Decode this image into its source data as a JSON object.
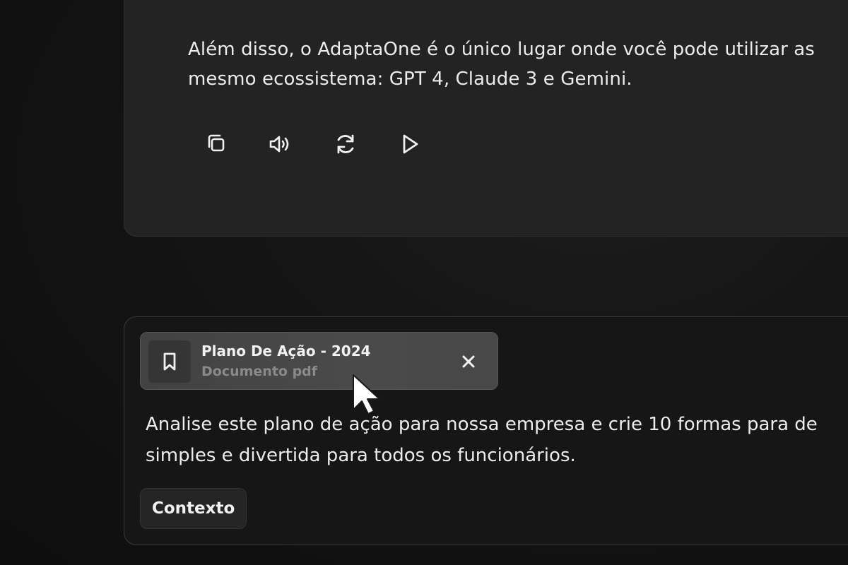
{
  "assistant_message": {
    "lines": [
      "Além disso, o AdaptaOne é o único lugar onde você pode utilizar as",
      "mesmo ecossistema: GPT 4, Claude 3 e Gemini."
    ],
    "actions": [
      {
        "name": "copy-icon",
        "label": "Copiar"
      },
      {
        "name": "speaker-icon",
        "label": "Ouvir"
      },
      {
        "name": "refresh-icon",
        "label": "Regenerar"
      },
      {
        "name": "play-icon",
        "label": "Continuar"
      }
    ]
  },
  "user_message": {
    "attachment": {
      "title": "Plano De Ação - 2024",
      "subtitle": "Documento pdf",
      "icon": "bookmark-icon",
      "close_icon": "close-icon"
    },
    "lines": [
      "Analise este plano de ação para nossa empresa e crie 10 formas para de",
      "simples e divertida para todos os funcionários."
    ],
    "context_button": "Contexto"
  },
  "colors": {
    "background": "#111111",
    "assistant_card": "#232323",
    "user_card": "#161616",
    "chip": "#464646",
    "text_primary": "#ececec",
    "text_muted": "#8a8a8a"
  }
}
